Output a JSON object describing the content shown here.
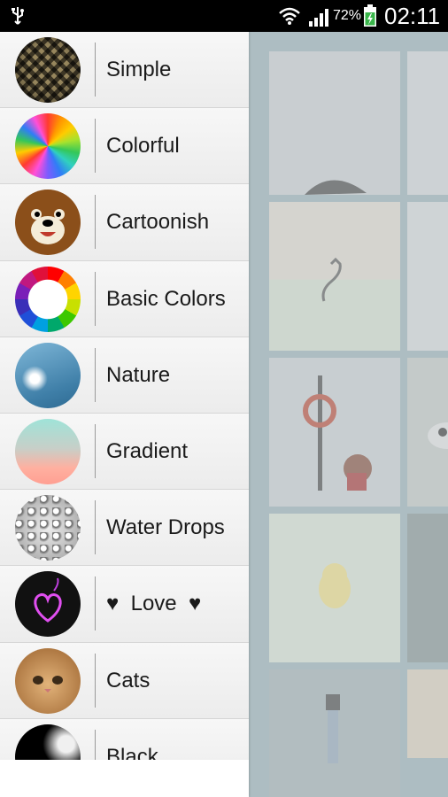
{
  "status_bar": {
    "battery_percent": "72%",
    "time": "02:11",
    "icons": [
      "usb-icon",
      "wifi-icon",
      "signal-icon",
      "battery-charging-icon"
    ]
  },
  "drawer": {
    "items": [
      {
        "label": "Simple",
        "thumbnail": "checkered-pattern-thumbnail"
      },
      {
        "label": "Colorful",
        "thumbnail": "rainbow-burst-thumbnail"
      },
      {
        "label": "Cartoonish",
        "thumbnail": "cartoon-bear-thumbnail"
      },
      {
        "label": "Basic Colors",
        "thumbnail": "color-wheel-thumbnail"
      },
      {
        "label": "Nature",
        "thumbnail": "dandelion-thumbnail"
      },
      {
        "label": "Gradient",
        "thumbnail": "gradient-thumbnail"
      },
      {
        "label": "Water Drops",
        "thumbnail": "water-drops-thumbnail"
      },
      {
        "label": "Love",
        "thumbnail": "heart-thumbnail",
        "decoration": "♥"
      },
      {
        "label": "Cats",
        "thumbnail": "cat-face-thumbnail"
      },
      {
        "label": "Black",
        "thumbnail": "black-smoke-thumbnail"
      }
    ]
  },
  "colors": {
    "status_bar_bg": "#000000",
    "drawer_bg": "#f2f2f2",
    "background_app": "#9fb3b8"
  }
}
